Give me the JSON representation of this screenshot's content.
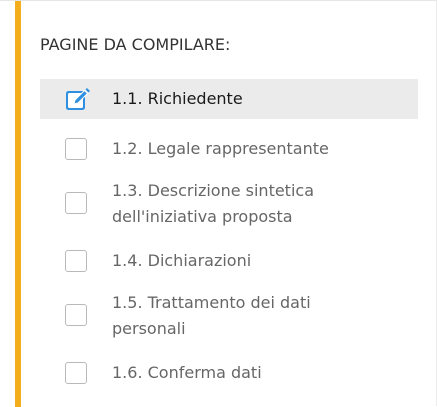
{
  "panel": {
    "heading": "PAGINE DA COMPILARE:",
    "accent_color": "#f4ae1d",
    "items": [
      {
        "lines": [
          "1.1. Richiedente"
        ],
        "state": "active",
        "icon": "edit-icon"
      },
      {
        "lines": [
          "1.2. Legale rappresentante"
        ],
        "state": "unchecked",
        "icon": "checkbox"
      },
      {
        "lines": [
          "1.3. Descrizione sintetica",
          "dell'iniziativa proposta"
        ],
        "state": "unchecked",
        "icon": "checkbox"
      },
      {
        "lines": [
          "1.4. Dichiarazioni"
        ],
        "state": "unchecked",
        "icon": "checkbox"
      },
      {
        "lines": [
          "1.5. Trattamento dei dati",
          "personali"
        ],
        "state": "unchecked",
        "icon": "checkbox"
      },
      {
        "lines": [
          "1.6. Conferma dati"
        ],
        "state": "unchecked",
        "icon": "checkbox"
      }
    ]
  }
}
